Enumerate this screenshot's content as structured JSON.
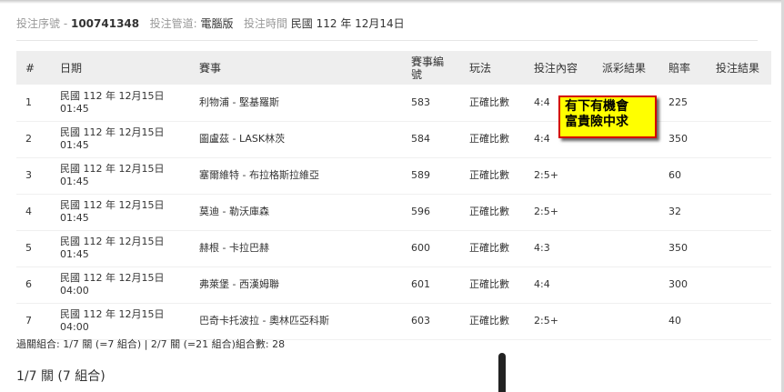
{
  "header": {
    "serial_label": "投注序號 -",
    "serial_value": "100741348",
    "channel_label": "投注管道:",
    "channel_value": "電腦版",
    "time_label": "投注時間",
    "time_value": "民國 112 年 12月14日"
  },
  "table": {
    "columns": [
      "#",
      "日期",
      "賽事",
      "賽事編號",
      "玩法",
      "投注內容",
      "派彩結果",
      "賠率",
      "投注結果"
    ],
    "rows": [
      {
        "no": "1",
        "date": "民國 112 年 12月15日\n01:45",
        "match": "利物浦 - 堅基羅斯",
        "match_no": "583",
        "play": "正確比數",
        "bet": "4:4",
        "payout": "",
        "odds": "225",
        "result": ""
      },
      {
        "no": "2",
        "date": "民國 112 年 12月15日\n01:45",
        "match": "圖盧茲 - LASK林茨",
        "match_no": "584",
        "play": "正確比數",
        "bet": "4:4",
        "payout": "",
        "odds": "350",
        "result": ""
      },
      {
        "no": "3",
        "date": "民國 112 年 12月15日\n01:45",
        "match": "塞爾維特 - 布拉格斯拉維亞",
        "match_no": "589",
        "play": "正確比數",
        "bet": "2:5+",
        "payout": "",
        "odds": "60",
        "result": ""
      },
      {
        "no": "4",
        "date": "民國 112 年 12月15日\n01:45",
        "match": "莫迪 - 勒沃庫森",
        "match_no": "596",
        "play": "正確比數",
        "bet": "2:5+",
        "payout": "",
        "odds": "32",
        "result": ""
      },
      {
        "no": "5",
        "date": "民國 112 年 12月15日\n01:45",
        "match": "赫根 - 卡拉巴赫",
        "match_no": "600",
        "play": "正確比數",
        "bet": "4:3",
        "payout": "",
        "odds": "350",
        "result": ""
      },
      {
        "no": "6",
        "date": "民國 112 年 12月15日\n04:00",
        "match": "弗萊堡 - 西漢姆聯",
        "match_no": "601",
        "play": "正確比數",
        "bet": "4:4",
        "payout": "",
        "odds": "300",
        "result": ""
      },
      {
        "no": "7",
        "date": "民國 112 年 12月15日\n04:00",
        "match": "巴奇卡托波拉 - 奧林匹亞科斯",
        "match_no": "603",
        "play": "正確比數",
        "bet": "2:5+",
        "payout": "",
        "odds": "40",
        "result": ""
      }
    ]
  },
  "summary": "過關組合: 1/7 關 (=7 組合) | 2/7 關 (=21 組合)組合數: 28",
  "section_title": "1/7 關 (7 組合)",
  "sticker": {
    "line1": "有下有機會",
    "line2": "富貴險中求"
  }
}
